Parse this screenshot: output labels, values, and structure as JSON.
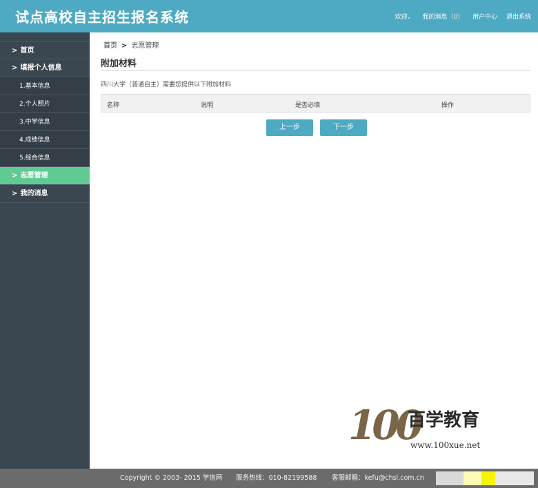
{
  "header": {
    "title": "试点高校自主招生报名系统",
    "welcome": "欢迎，",
    "messages_label": "我的消息",
    "messages_count": "（0）",
    "user_center": "用户中心",
    "logout": "退出系统"
  },
  "sidebar": {
    "items": [
      {
        "label": "首页",
        "chevron": ">"
      },
      {
        "label": "填报个人信息",
        "chevron": ">"
      },
      {
        "label": "1.基本信息"
      },
      {
        "label": "2.个人照片"
      },
      {
        "label": "3.中学信息"
      },
      {
        "label": "4.成绩信息"
      },
      {
        "label": "5.综合信息"
      },
      {
        "label": "志愿管理",
        "chevron": ">"
      },
      {
        "label": "我的消息",
        "chevron": ">"
      }
    ]
  },
  "breadcrumb": {
    "home": "首页",
    "separator": ">",
    "current": "志愿管理"
  },
  "main": {
    "title": "附加材料",
    "notice": "四川大学（普通自主）需要您提供以下附加材料",
    "table": {
      "columns": [
        "名称",
        "说明",
        "是否必填",
        "操作"
      ]
    },
    "prev_button": "上一步",
    "next_button": "下一步"
  },
  "watermark": {
    "number": "100",
    "name": "百学教育",
    "url": "www.100xue.net"
  },
  "footer": {
    "copyright": "Copyright © 2003- 2015 学信网",
    "hotline": "服务热线：010-82199588",
    "email": "客服邮箱：kefu@chsi.com.cn"
  },
  "colors": {
    "header": "#4ea9c2",
    "sidebar": "#3a4650",
    "active": "#5fcb93",
    "footer": "#6b6b6b"
  }
}
